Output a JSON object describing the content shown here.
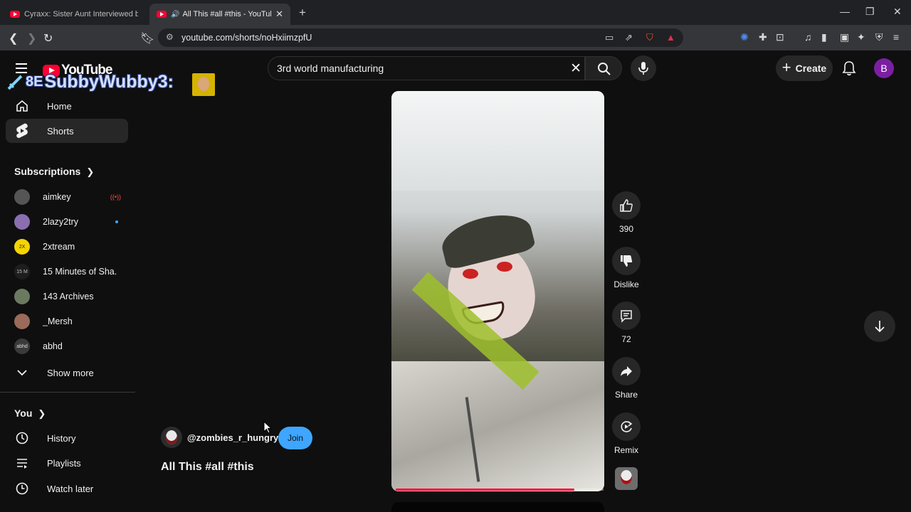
{
  "browser": {
    "tabs": [
      {
        "title": "Cyraxx: Sister Aunt Interviewed by Tr",
        "active": false
      },
      {
        "title": "All This #all #this - YouTube",
        "active": true
      }
    ],
    "url": "youtube.com/shorts/noHxiimzpfU"
  },
  "header": {
    "logo_text": "YouTube",
    "search_query": "3rd world manufacturing",
    "create_label": "Create",
    "avatar_letter": "B"
  },
  "overlay": {
    "streamer_name": "SubbyWubby3:"
  },
  "sidebar": {
    "main": [
      {
        "label": "Home",
        "icon": "home-icon"
      },
      {
        "label": "Shorts",
        "icon": "shorts-icon"
      }
    ],
    "subscriptions_title": "Subscriptions",
    "subscriptions": [
      {
        "label": "aimkey",
        "live": true,
        "color": "#555555"
      },
      {
        "label": "2lazy2try",
        "new": true,
        "color": "#8a6fb0"
      },
      {
        "label": "2xtream",
        "color": "#f5d400",
        "avatar_text": "2X"
      },
      {
        "label": "15 Minutes of Sha...",
        "color": "#1e1e1e",
        "avatar_text": "15 M"
      },
      {
        "label": "143 Archives",
        "color": "#6b7a5f"
      },
      {
        "label": "_Mersh",
        "color": "#9a6a5a"
      },
      {
        "label": "abhd",
        "color": "#3a3a3a",
        "avatar_text": "abhd"
      }
    ],
    "show_more": "Show more",
    "you_title": "You",
    "you_items": [
      {
        "label": "History",
        "icon": "history-icon"
      },
      {
        "label": "Playlists",
        "icon": "playlists-icon"
      },
      {
        "label": "Watch later",
        "icon": "watch-later-icon"
      }
    ]
  },
  "short": {
    "channel": "@zombies_r_hungry",
    "join_label": "Join",
    "title": "All This #all #this",
    "progress": 0.86,
    "actions": {
      "likes": "390",
      "dislike_label": "Dislike",
      "comments": "72",
      "share_label": "Share",
      "remix_label": "Remix"
    }
  },
  "colors": {
    "accent_red": "#ff0033",
    "join_blue": "#3ea6ff",
    "background": "#0f0f0f"
  }
}
